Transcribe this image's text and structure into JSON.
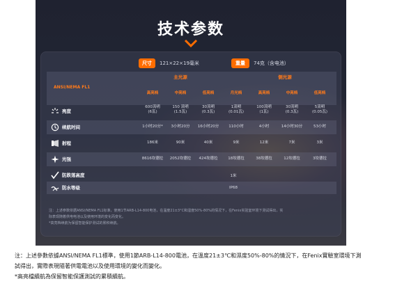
{
  "title": "技术参数",
  "size": {
    "label": "尺寸",
    "value": "121×22×19毫米"
  },
  "weight": {
    "label": "重量",
    "value": "74克（含电池）"
  },
  "header": {
    "standard": "ANSI/NEMA FL1",
    "main_light": "主光源",
    "side_light": "侧光源",
    "modes": [
      "高亮档",
      "中亮档",
      "低亮档",
      "月光档",
      "高亮档",
      "中亮档",
      "低亮档"
    ]
  },
  "rows": {
    "brightness": {
      "label": "亮度",
      "values": [
        "600流明\n(6瓦)",
        "150 流明\n(1.5瓦)",
        "30流明\n(0.3瓦)",
        "1流明\n(0.01瓦)",
        "100流明\n(1瓦)",
        "30流明\n(0.3瓦)",
        "5流明\n(0.05瓦)"
      ]
    },
    "runtime": {
      "label": "续航时间",
      "values": [
        "1小时20分*",
        "3小时20分",
        "16小时20分",
        "110小时",
        "4小时",
        "14小时30分",
        "53小时"
      ]
    },
    "distance": {
      "label": "射程",
      "values": [
        "186米",
        "90米",
        "40米",
        "9米",
        "12米",
        "7米",
        "3米"
      ]
    },
    "intensity": {
      "label": "光强",
      "values": [
        "8616坎德拉",
        "2052坎德拉",
        "424坎德拉",
        "18坎德拉",
        "38坎德拉",
        "12坎德拉",
        "3坎德拉"
      ]
    },
    "impact": {
      "label": "防跌落高度",
      "value": "1米"
    },
    "water": {
      "label": "防水等级",
      "value": "IP68"
    }
  },
  "footnotes": [
    "注：上述参数依据ANSI/NEMA FL1标准，使用1节ARB-L14-800电池，在温度21±3°C和湿度50%-80%的情况下，在Fenix实验室环境下测试得出，实",
    "际表现随着供电电池以及使用环境的变化而变化。",
    "*高亮档续航为保留智能保护测试的累积续航。"
  ],
  "caption": [
    "注：上述參數依據ANSI/NEMA FL1標準，使用1節ARB-L14-800電池，在溫度21±3℃和濕度50%-80%的情況下，在Fenix實驗室環境下測",
    "試得出，實際表現隨著供電電池以及使用環境的變化而變化。",
    "*高亮檔續航為保留智能保護測試的累積續航。"
  ],
  "colors": {
    "accent": "#ff6d00",
    "accent_text": "#ff7a1a"
  }
}
